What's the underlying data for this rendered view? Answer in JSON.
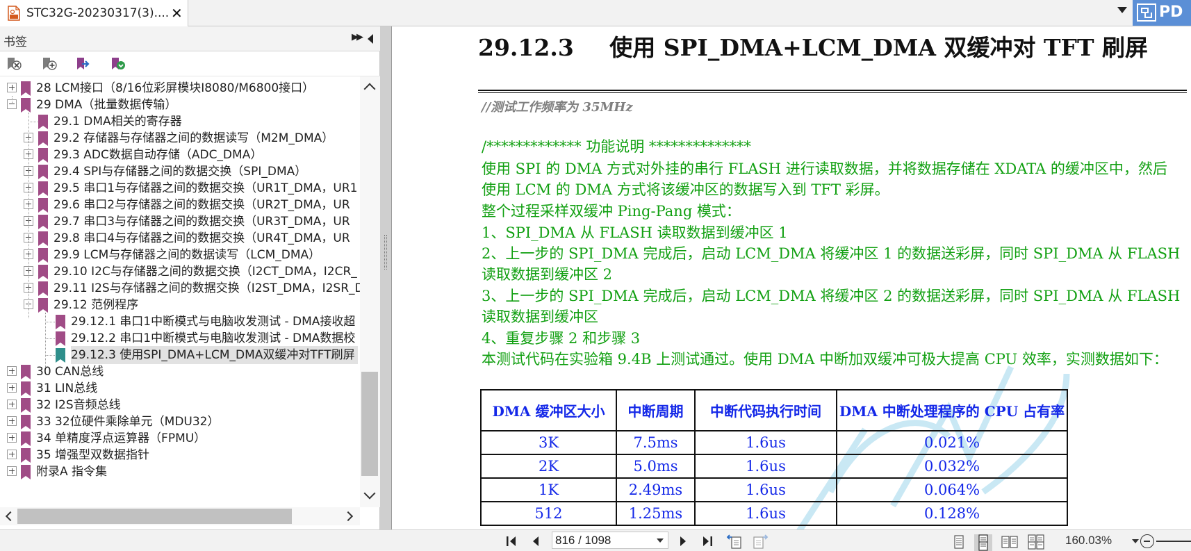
{
  "tab": {
    "title": "STC32G-20230317(3)....",
    "close": "✕"
  },
  "app_button": {
    "label": "PD"
  },
  "sidebar": {
    "title": "书签"
  },
  "bookmarks": [
    {
      "text": "28 LCM接口（8/16位彩屏模块I8080/M6800接口）",
      "expander": "plus"
    },
    {
      "text": "29 DMA（批量数据传输）",
      "expander": "minus"
    },
    {
      "text": "29.1 DMA相关的寄存器",
      "expander": ""
    },
    {
      "text": "29.2 存储器与存储器之间的数据读写（M2M_DMA）",
      "expander": "plus"
    },
    {
      "text": "29.3 ADC数据自动存储（ADC_DMA）",
      "expander": "plus"
    },
    {
      "text": "29.4 SPI与存储器之间的数据交换（SPI_DMA）",
      "expander": "plus"
    },
    {
      "text": "29.5 串口1与存储器之间的数据交换（UR1T_DMA，UR1",
      "expander": "plus"
    },
    {
      "text": "29.6 串口2与存储器之间的数据交换（UR2T_DMA，UR",
      "expander": "plus"
    },
    {
      "text": "29.7 串口3与存储器之间的数据交换（UR3T_DMA，UR",
      "expander": "plus"
    },
    {
      "text": "29.8 串口4与存储器之间的数据交换（UR4T_DMA，UR",
      "expander": "plus"
    },
    {
      "text": "29.9 LCM与存储器之间的数据读写（LCM_DMA）",
      "expander": "plus"
    },
    {
      "text": "29.10 I2C与存储器之间的数据交换（I2CT_DMA，I2CR_",
      "expander": "plus"
    },
    {
      "text": "29.11 I2S与存储器之间的数据交换（I2ST_DMA，I2SR_D",
      "expander": "plus"
    },
    {
      "text": "29.12 范例程序",
      "expander": "minus"
    },
    {
      "text": "29.12.1 串口1中断模式与电脑收发测试 - DMA接收超",
      "expander": ""
    },
    {
      "text": "29.12.2 串口1中断模式与电脑收发测试 - DMA数据校",
      "expander": ""
    },
    {
      "text": "29.12.3 使用SPI_DMA+LCM_DMA双缓冲对TFT刷屏",
      "expander": "",
      "selected": true
    },
    {
      "text": "30 CAN总线",
      "expander": "plus"
    },
    {
      "text": "31 LIN总线",
      "expander": "plus"
    },
    {
      "text": "32 I2S音频总线",
      "expander": "plus"
    },
    {
      "text": "33 32位硬件乘除单元（MDU32）",
      "expander": "plus"
    },
    {
      "text": "34 单精度浮点运算器（FPMU）",
      "expander": "plus"
    },
    {
      "text": "35 增强型双数据指针",
      "expander": "plus"
    },
    {
      "text": "附录A 指令集",
      "expander": "plus"
    }
  ],
  "document": {
    "heading_number": "29.12.3",
    "heading_text": "使用 SPI_DMA+LCM_DMA 双缓冲对 TFT 刷屏",
    "comment": "//测试工作频率为 35MHz",
    "lines": [
      "/*************   功能说明    **************",
      "使用 SPI 的 DMA 方式对外挂的串行 FLASH 进行读取数据，并将数据存储在 XDATA 的缓冲区中，然后",
      "使用 LCM 的 DMA 方式将该缓冲区的数据写入到 TFT 彩屏。",
      "整个过程采样双缓冲 Ping-Pang 模式：",
      "1、SPI_DMA 从 FLASH 读取数据到缓冲区 1",
      "2、上一步的 SPI_DMA 完成后，启动 LCM_DMA 将缓冲区 1 的数据送彩屏，同时 SPI_DMA 从 FLASH",
      "读取数据到缓冲区 2",
      "3、上一步的 SPI_DMA 完成后，启动 LCM_DMA 将缓冲区 2 的数据送彩屏，同时 SPI_DMA 从 FLASH",
      "读取数据到缓冲区",
      "4、重复步骤 2 和步骤 3",
      "本测试代码在实验箱 9.4B 上测试通过。使用 DMA 中断加双缓冲可极大提高 CPU 效率，实测数据如下："
    ],
    "table": {
      "headers": [
        "DMA 缓冲区大小",
        "中断周期",
        "中断代码执行时间",
        "DMA 中断处理程序的 CPU 占有率"
      ],
      "rows": [
        [
          "3K",
          "7.5ms",
          "1.6us",
          "0.021%"
        ],
        [
          "2K",
          "5.0ms",
          "1.6us",
          "0.032%"
        ],
        [
          "1K",
          "2.49ms",
          "1.6us",
          "0.064%"
        ],
        [
          "512",
          "1.25ms",
          "1.6us",
          "0.128%"
        ]
      ]
    }
  },
  "statusbar": {
    "page": "816 / 1098",
    "zoom": "160.03%"
  },
  "colors": {
    "bookmark": "#a04c86",
    "bookmark_selected": "#2f8f8b",
    "code_green": "#12a012",
    "table_blue": "#1428e8",
    "app_blue": "#5b8fd6"
  }
}
